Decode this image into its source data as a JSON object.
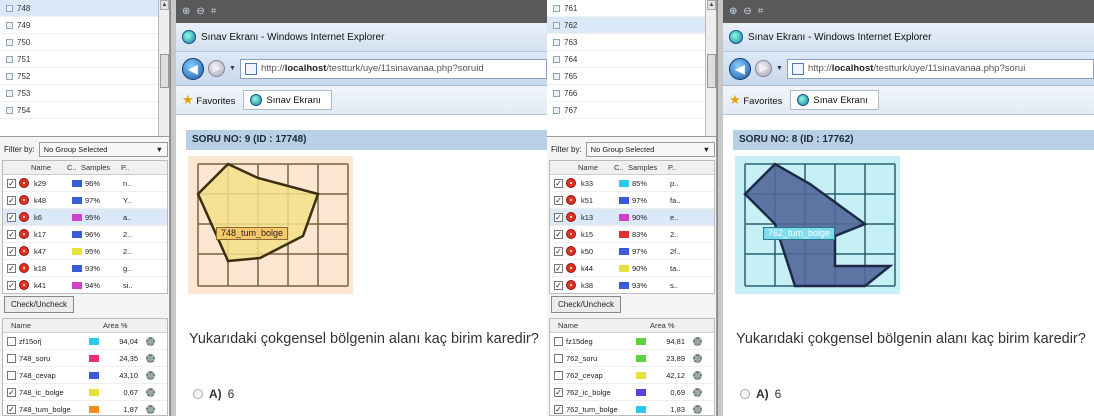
{
  "left": {
    "items": [
      "748",
      "749",
      "750",
      "751",
      "752",
      "753",
      "754"
    ],
    "selected_item_index": 0,
    "filter_label": "Filter by:",
    "filter_value": "No Group Selected",
    "group_headers": {
      "name": "Name",
      "c": "C..",
      "samples": "Samples",
      "p": "P.."
    },
    "groups": [
      {
        "name": "k29",
        "color": "#3a5ad8",
        "samples": "96%",
        "p": "n.."
      },
      {
        "name": "k48",
        "color": "#3a5ad8",
        "samples": "97%",
        "p": "Y.."
      },
      {
        "name": "k6",
        "color": "#d040c8",
        "samples": "95%",
        "p": "a..",
        "highlight": true
      },
      {
        "name": "k17",
        "color": "#3a5ad8",
        "samples": "96%",
        "p": "2.."
      },
      {
        "name": "k47",
        "color": "#e8e040",
        "samples": "95%",
        "p": "2.."
      },
      {
        "name": "k18",
        "color": "#3a5ad8",
        "samples": "93%",
        "p": "g.."
      },
      {
        "name": "k41",
        "color": "#d040c8",
        "samples": "94%",
        "p": "si.."
      }
    ],
    "check_button": "Check/Uncheck",
    "area_headers": {
      "name": "Name",
      "area": "Area %"
    },
    "areas": [
      {
        "name": "zf15orj",
        "checked": false,
        "color": "#30c8e8",
        "value": "94,04"
      },
      {
        "name": "748_soru",
        "checked": false,
        "color": "#e83078",
        "value": "24,35"
      },
      {
        "name": "748_cevap",
        "checked": false,
        "color": "#3a5ad8",
        "value": "43,10"
      },
      {
        "name": "748_ic_bolge",
        "checked": true,
        "color": "#e8e040",
        "value": "0,67"
      },
      {
        "name": "748_tum_bolge",
        "checked": true,
        "color": "#f09020",
        "value": "1,87"
      }
    ],
    "browser": {
      "title": "Sınav Ekranı - Windows Internet Explorer",
      "url_prefix": "http://",
      "url_host": "localhost",
      "url_path": "/testturk/uye/11sinavanaa.php?soruid",
      "favorites": "Favorites",
      "tab": "Sınav Ekranı"
    },
    "question_header": "SORU NO: 9 (ID : 17748)",
    "region_label": "748_tum_bolge",
    "question": "Yukarıdaki çokgensel bölgenin alanı kaç birim karedir?",
    "option": {
      "letter": "A)",
      "value": "6"
    }
  },
  "right": {
    "items": [
      "761",
      "762",
      "763",
      "764",
      "765",
      "766",
      "767"
    ],
    "selected_item_index": 1,
    "filter_label": "Filter by:",
    "filter_value": "No Group Selected",
    "group_headers": {
      "name": "Name",
      "c": "C..",
      "samples": "Samples",
      "p": "P.."
    },
    "groups": [
      {
        "name": "k33",
        "color": "#30c8e8",
        "samples": "85%",
        "p": "p.."
      },
      {
        "name": "k51",
        "color": "#3a5ad8",
        "samples": "97%",
        "p": "fa.."
      },
      {
        "name": "k13",
        "color": "#d040c8",
        "samples": "90%",
        "p": "e..",
        "highlight": true
      },
      {
        "name": "k15",
        "color": "#e03030",
        "samples": "83%",
        "p": "2.."
      },
      {
        "name": "k50",
        "color": "#3a5ad8",
        "samples": "97%",
        "p": "2f.."
      },
      {
        "name": "k44",
        "color": "#e8e040",
        "samples": "90%",
        "p": "ta.."
      },
      {
        "name": "k38",
        "color": "#3a5ad8",
        "samples": "93%",
        "p": "s.."
      }
    ],
    "check_button": "Check/Uncheck",
    "area_headers": {
      "name": "Name",
      "area": "Area %"
    },
    "areas": [
      {
        "name": "fz15deg",
        "checked": false,
        "color": "#60d040",
        "value": "94,81"
      },
      {
        "name": "762_soru",
        "checked": false,
        "color": "#60d040",
        "value": "23,89"
      },
      {
        "name": "762_cevap",
        "checked": false,
        "color": "#e8e040",
        "value": "42,12"
      },
      {
        "name": "762_ic_bolge",
        "checked": true,
        "color": "#6040d0",
        "value": "0,69"
      },
      {
        "name": "762_tum_bolge",
        "checked": true,
        "color": "#30c8e8",
        "value": "1,83"
      }
    ],
    "browser": {
      "title": "Sınav Ekranı - Windows Internet Explorer",
      "url_prefix": "http://",
      "url_host": "localhost",
      "url_path": "/testturk/uye/11sinavanaa.php?sorui",
      "favorites": "Favorites",
      "tab": "Sınav Ekranı"
    },
    "question_header": "SORU NO: 8 (ID : 17762)",
    "region_label": "762_tum_bolge",
    "question": "Yukarıdaki çokgensel bölgenin alanı kaç birim karedir?",
    "option": {
      "letter": "A)",
      "value": "6"
    }
  }
}
